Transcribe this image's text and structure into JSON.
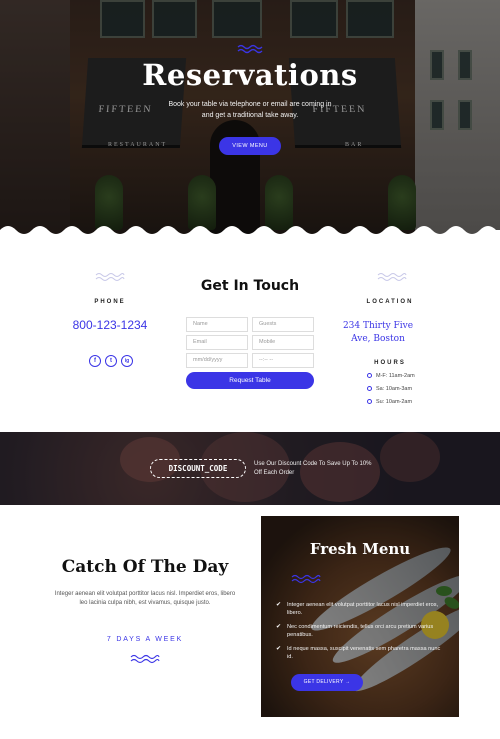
{
  "hero": {
    "title": "Reservations",
    "subtitle": "Book your table via telephone or email are coming in and get a traditional take away.",
    "button": "VIEW MENU",
    "awning_left": "FIFTEEN",
    "awning_left_sign": "RESTAURANT",
    "awning_right": "FIFTEEN",
    "awning_right_sign": "BAR"
  },
  "contact": {
    "phone_label": "PHONE",
    "phone_number": "800-123-1234",
    "title": "Get In Touch",
    "form": {
      "name_placeholder": "Name",
      "guests_placeholder": "Guests",
      "email_placeholder": "Email",
      "mobile_placeholder": "Mobile",
      "date_placeholder": "mm/dd/yyyy",
      "time_placeholder": "--:-- --",
      "submit": "Request Table"
    },
    "location_label": "LOCATION",
    "address": "234 Thirty Five Ave, Boston",
    "hours_label": "HOURS",
    "hours": [
      "M-F: 11am-2am",
      "Sa: 10am-3am",
      "Su: 10am-2am"
    ],
    "social": [
      "f",
      "t",
      "ig"
    ]
  },
  "discount": {
    "code": "DISCOUNT_CODE",
    "description": "Use Our Discount Code To Save Up To 10% Off Each Order"
  },
  "catch": {
    "title": "Catch Of The Day",
    "text": "Integer aenean elit volutpat porttitor lacus nisl. Imperdiet eros, libero leo lacinia culpa nibh, est vivamus, quisque justo.",
    "days": "7 DAYS A WEEK"
  },
  "menu": {
    "title": "Fresh Menu",
    "items": [
      "Integer aenean elit volutpat porttitor lacus nisl imperdiet eros, libero.",
      "Nec condimentum reiciendis, tellus orci arcu pretium varius penatibus.",
      "Id neque massa, suscipit venenatis sem pharetra massa nunc id."
    ],
    "button": "GET DELIVERY →"
  },
  "colors": {
    "accent": "#3b35e6"
  }
}
